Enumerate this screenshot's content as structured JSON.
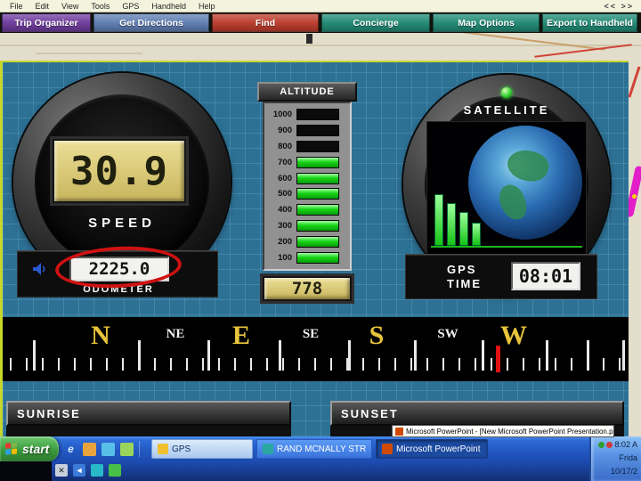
{
  "menubar": {
    "items": [
      "File",
      "Edit",
      "View",
      "Tools",
      "GPS",
      "Handheld",
      "Help"
    ],
    "arrows": "<<  >>"
  },
  "toolbar": {
    "buttons": [
      {
        "label": "Trip Organizer",
        "color": "#6e3a9e"
      },
      {
        "label": "Get Directions",
        "color": "#5d7db2"
      },
      {
        "label": "Find",
        "color": "#bc3a2a"
      },
      {
        "label": "Concierge",
        "color": "#1e8a74"
      },
      {
        "label": "Map Options",
        "color": "#1e8a74"
      },
      {
        "label": "Export to Handheld",
        "color": "#1e8a74"
      }
    ]
  },
  "dashboard": {
    "background_color": "#2d7195",
    "accent_line_color": "#c6d62a",
    "speed": {
      "value": "30.9",
      "label": "SPEED"
    },
    "odometer": {
      "value": "2225.0",
      "label": "ODOMETER",
      "annotation_color": "#cf1212"
    },
    "altitude": {
      "title": "ALTITUDE",
      "scale": [
        "1000",
        "900",
        "800",
        "700",
        "600",
        "500",
        "400",
        "300",
        "200",
        "100"
      ],
      "value": "778",
      "bar_color": "#17d417"
    },
    "satellite": {
      "title": "SATELLITE",
      "status_led_color": "#35d435",
      "signal_bars": [
        58,
        48,
        38,
        26
      ],
      "gps_line1": "GPS",
      "gps_line2": "TIME",
      "time": "08:01"
    },
    "compass": {
      "points": [
        {
          "label": "N",
          "major": true
        },
        {
          "label": "NE",
          "major": false
        },
        {
          "label": "E",
          "major": true
        },
        {
          "label": "SE",
          "major": false
        },
        {
          "label": "S",
          "major": true
        },
        {
          "label": "SW",
          "major": false
        },
        {
          "label": "W",
          "major": true
        }
      ],
      "major_color": "#e8c43c",
      "heading_marker_color": "#e01212"
    },
    "sunrise_label": "SUNRISE",
    "sunset_label": "SUNSET"
  },
  "tooltip": {
    "text": "Microsoft PowerPoint - [New Microsoft PowerPoint Presentation.ppt]"
  },
  "taskbar": {
    "start_label": "start",
    "quick_launch_icons": [
      {
        "name": "internet-explorer-icon",
        "glyph": "e"
      },
      {
        "name": "folder-icon",
        "glyph": ""
      },
      {
        "name": "media-player-icon",
        "glyph": ""
      },
      {
        "name": "mail-icon",
        "glyph": ""
      }
    ],
    "tasks": [
      {
        "label": "GPS"
      },
      {
        "label": "RAND MCNALLY STRE..."
      },
      {
        "label": "Microsoft PowerPoint ..."
      }
    ],
    "row2_icons": [
      {
        "name": "close-icon",
        "glyph": "✕"
      },
      {
        "name": "speaker-icon",
        "glyph": "◄"
      },
      {
        "name": "network-icon",
        "glyph": ""
      },
      {
        "name": "sync-icon",
        "glyph": ""
      }
    ],
    "tray": {
      "time": "8:02 A",
      "day": "Frida",
      "date": "10/17/2"
    }
  }
}
